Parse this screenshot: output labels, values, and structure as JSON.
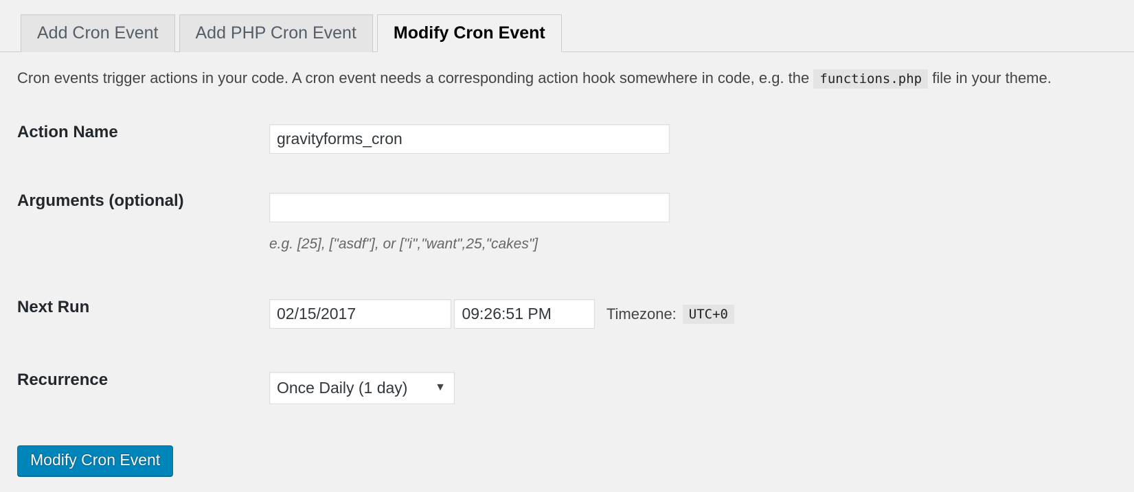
{
  "tabs": [
    {
      "label": "Add Cron Event",
      "active": false
    },
    {
      "label": "Add PHP Cron Event",
      "active": false
    },
    {
      "label": "Modify Cron Event",
      "active": true
    }
  ],
  "description": {
    "before_code": "Cron events trigger actions in your code. A cron event needs a corresponding action hook somewhere in code, e.g. the",
    "code": "functions.php",
    "after_code": "file in your theme."
  },
  "form": {
    "action_name": {
      "label": "Action Name",
      "value": "gravityforms_cron",
      "placeholder": ""
    },
    "arguments": {
      "label": "Arguments (optional)",
      "value": "",
      "placeholder": "",
      "help": "e.g. [25], [\"asdf\"], or [\"i\",\"want\",25,\"cakes\"]"
    },
    "next_run": {
      "label": "Next Run",
      "date_value": "02/15/2017",
      "time_value": "09:26:51 PM",
      "timezone_label": "Timezone:",
      "timezone_value": "UTC+0"
    },
    "recurrence": {
      "label": "Recurrence",
      "selected": "Once Daily (1 day)",
      "options": [
        "Once Daily (1 day)"
      ],
      "arrow": "▼"
    },
    "submit": {
      "label": "Modify Cron Event",
      "color": "#0085ba"
    }
  }
}
